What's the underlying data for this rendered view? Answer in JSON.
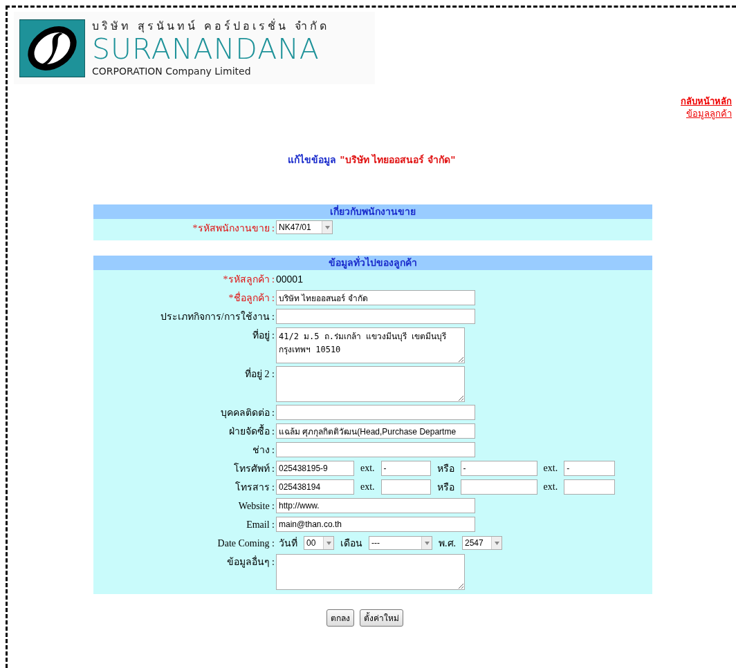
{
  "logo": {
    "thai_name": "บริษัท สุรนันทน์ คอร์ปอเรชั่น จำกัด",
    "name": "SURANANDANA",
    "subtitle": "CORPORATION Company Limited"
  },
  "nav_links": [
    "กลับหน้าหลัก",
    "ข้อมูลลูกค้า"
  ],
  "page_title": {
    "prefix": "แก้ไขข้อมูล",
    "name": "\"บริษัท ไทยออสนอร์ จำกัด\""
  },
  "sections": [
    {
      "title": "เกี่ยวกับพนักงานขาย",
      "rows": [
        {
          "label": "*รหัสพนักงานขาย :",
          "required": true,
          "kind": "select",
          "value": "NK47/01"
        }
      ]
    },
    {
      "title": "ข้อมูลทั่วไปของลูกค้า",
      "rows": [
        {
          "label": "*รหัสลูกค้า :",
          "required": true,
          "kind": "static",
          "value": "00001"
        },
        {
          "label": "*ชื่อลูกค้า :",
          "required": true,
          "kind": "input",
          "value": "บริษัท ไทยออสนอร์ จำกัด"
        },
        {
          "label": "ประเภทกิจการ/การใช้งาน :",
          "required": false,
          "kind": "input"
        },
        {
          "label": "ที่อยู่ :",
          "required": false,
          "kind": "textarea",
          "value": "41/2 ม.5 ถ.ร่มเกล้า แขวงมีนบุรี เขตมีนบุรี\nกรุงเทพฯ 10510"
        },
        {
          "label": "ที่อยู่ 2 :",
          "required": false,
          "kind": "textarea"
        },
        {
          "label": "บุคคลติดต่อ :",
          "required": false,
          "kind": "input"
        },
        {
          "label": "ฝ่ายจัดซื้อ :",
          "required": false,
          "kind": "input",
          "value": "แฉล้ม ศุภกุลกิตติวัฒน(Head,Purchase Departme"
        },
        {
          "label": "ช่าง :",
          "required": false,
          "kind": "input"
        },
        {
          "label": "โทรศัพท์ :",
          "required": false,
          "kind": "inline",
          "parts": [
            {
              "kind": "input",
              "value": "025438195-9"
            },
            {
              "kind": "text",
              "text": "ext."
            },
            {
              "kind": "input",
              "value": "-"
            },
            {
              "kind": "text",
              "text": "หรือ"
            },
            {
              "kind": "input",
              "value": "-"
            },
            {
              "kind": "text",
              "text": "ext."
            },
            {
              "kind": "input",
              "value": "-"
            }
          ]
        },
        {
          "label": "โทรสาร :",
          "required": false,
          "kind": "inline",
          "parts": [
            {
              "kind": "input",
              "value": "025438194"
            },
            {
              "kind": "text",
              "text": "ext."
            },
            {
              "kind": "input"
            },
            {
              "kind": "text",
              "text": "หรือ"
            },
            {
              "kind": "input"
            },
            {
              "kind": "text",
              "text": "ext."
            },
            {
              "kind": "input"
            }
          ]
        },
        {
          "label": "Website :",
          "required": false,
          "kind": "input",
          "value": "http://www."
        },
        {
          "label": "Email :",
          "required": false,
          "kind": "input",
          "value": "main@than.co.th"
        },
        {
          "label": "Date Coming :",
          "required": false,
          "kind": "inline",
          "parts": [
            {
              "kind": "text",
              "text": "วันที่"
            },
            {
              "kind": "select",
              "value": "00"
            },
            {
              "kind": "text",
              "text": "เดือน"
            },
            {
              "kind": "select",
              "value": "---"
            },
            {
              "kind": "text",
              "text": "พ.ศ."
            },
            {
              "kind": "select",
              "value": "2547"
            }
          ]
        },
        {
          "label": "ข้อมูลอื่นๆ :",
          "required": false,
          "kind": "textarea"
        }
      ]
    }
  ],
  "buttons": [
    "ตกลง",
    "ตั้งค่าใหม่"
  ]
}
